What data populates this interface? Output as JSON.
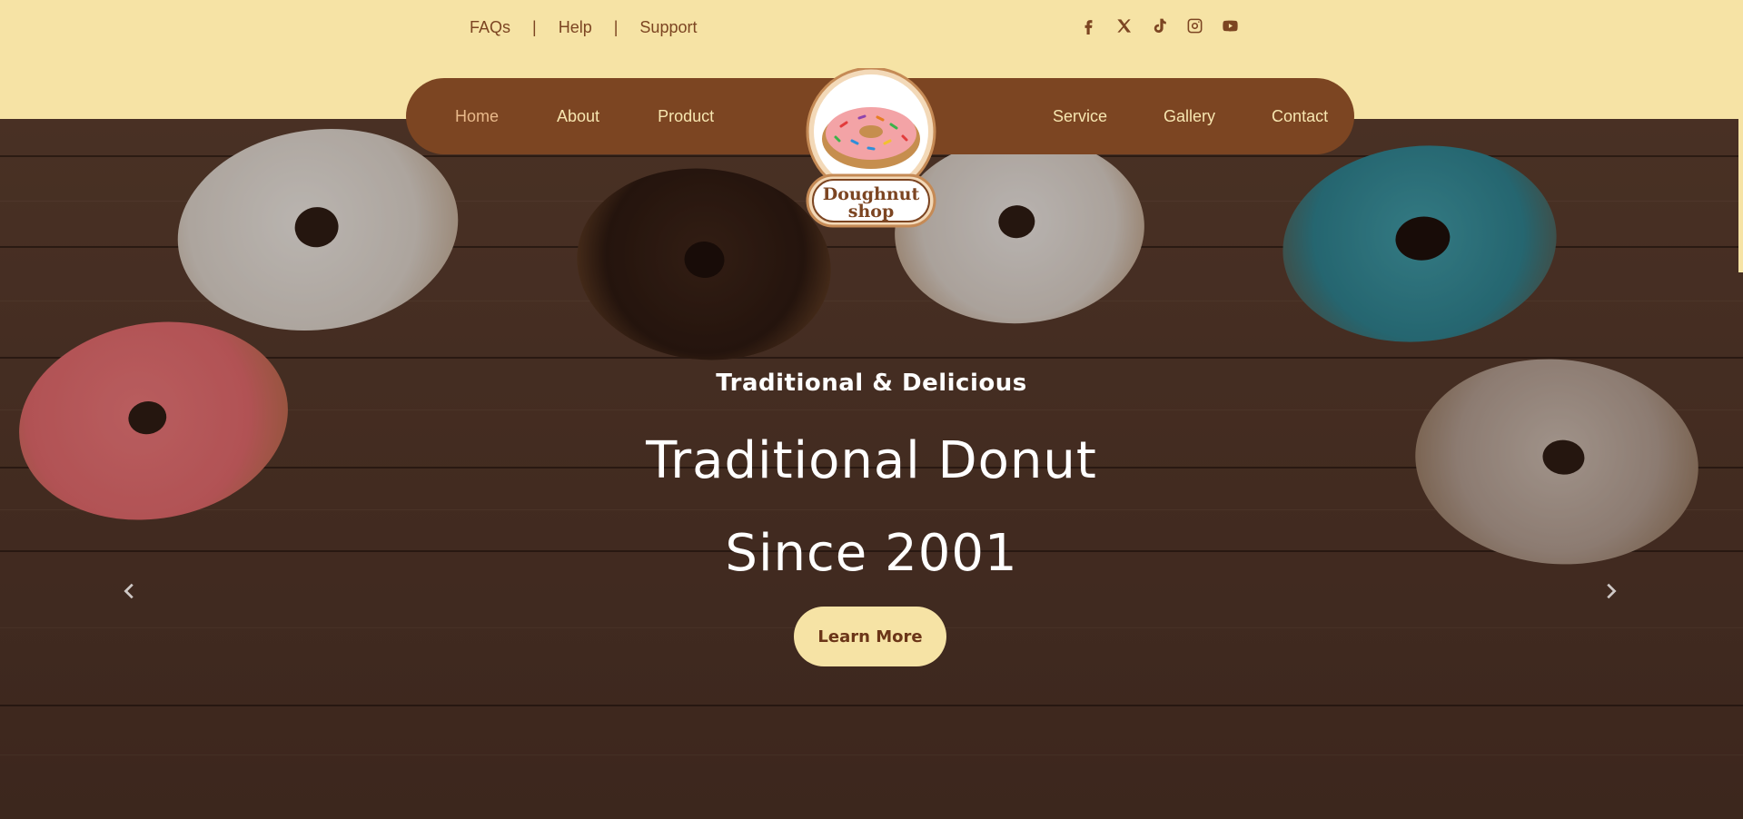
{
  "colors": {
    "brand_brown": "#7c4522",
    "cream": "#f6e3a5",
    "text_light": "#f7e6b0"
  },
  "top_links": [
    {
      "label": "FAQs"
    },
    {
      "label": "Help"
    },
    {
      "label": "Support"
    }
  ],
  "separator": "|",
  "social_icons": [
    "facebook-icon",
    "x-icon",
    "tiktok-icon",
    "instagram-icon",
    "youtube-icon"
  ],
  "nav": {
    "left": [
      {
        "label": "Home"
      },
      {
        "label": "About"
      },
      {
        "label": "Product"
      }
    ],
    "right": [
      {
        "label": "Service"
      },
      {
        "label": "Gallery"
      },
      {
        "label": "Contact"
      }
    ],
    "active": "Home"
  },
  "logo": {
    "line1": "Doughnut",
    "line2": "shop"
  },
  "hero": {
    "kicker": "Traditional & Delicious",
    "headline_line1": "Traditional Donut",
    "headline_line2": "Since 2001",
    "cta_label": "Learn More"
  }
}
